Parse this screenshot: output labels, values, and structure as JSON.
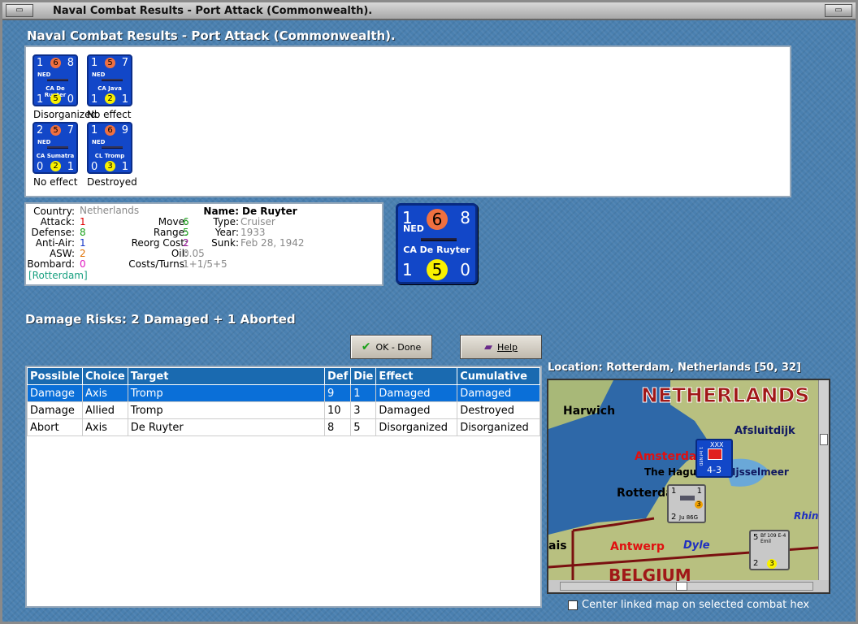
{
  "window": {
    "title": "Naval Combat Results - Port Attack (Commonwealth)."
  },
  "header": "Naval Combat Results - Port Attack (Commonwealth).",
  "units": [
    {
      "tl": "1",
      "tc": "6",
      "tr": "8",
      "nat": "NED",
      "name": "CA De Ruyter",
      "bl": "1",
      "bc": "5",
      "br": "0",
      "result": "Disorganized"
    },
    {
      "tl": "1",
      "tc": "5",
      "tr": "7",
      "nat": "NED",
      "name": "CA Java",
      "bl": "1",
      "bc": "2",
      "br": "1",
      "result": "No effect"
    },
    {
      "tl": "2",
      "tc": "5",
      "tr": "7",
      "nat": "NED",
      "name": "CA Sumatra",
      "bl": "0",
      "bc": "2",
      "br": "1",
      "result": "No effect"
    },
    {
      "tl": "1",
      "tc": "6",
      "tr": "9",
      "nat": "NED",
      "name": "CL Tromp",
      "bl": "0",
      "bc": "3",
      "br": "1",
      "result": "Destroyed"
    }
  ],
  "info": {
    "country_l": "Country:",
    "country": "Netherlands",
    "attack_l": "Attack:",
    "attack": "1",
    "defense_l": "Defense:",
    "defense": "8",
    "antiair_l": "Anti-Air:",
    "antiair": "1",
    "asw_l": "ASW:",
    "asw": "2",
    "bombard_l": "Bombard:",
    "bombard": "0",
    "port": "[Rotterdam]",
    "move_l": "Move:",
    "move": "6",
    "range_l": "Range:",
    "range": "5",
    "reorg_l": "Reorg Cost:",
    "reorg": "2",
    "oil_l": "Oil:",
    "oil": "0.05",
    "costs_l": "Costs/Turns:",
    "costs": "1+1/5+5",
    "name_l": "Name:",
    "name": "De Ruyter",
    "type_l": "Type:",
    "type": "Cruiser",
    "year_l": "Year:",
    "year": "1933",
    "sunk_l": "Sunk:",
    "sunk": "Feb 28, 1942"
  },
  "bigunit": {
    "tl": "1",
    "tc": "6",
    "tr": "8",
    "nat": "NED",
    "name": "CA De Ruyter",
    "bl": "1",
    "bc": "5",
    "br": "0"
  },
  "damage_risks": "Damage Risks: 2 Damaged + 1 Aborted",
  "buttons": {
    "ok": "OK - Done",
    "help": "Help"
  },
  "table": {
    "headers": [
      "Possible",
      "Choice",
      "Target",
      "Def",
      "Die",
      "Effect",
      "Cumulative"
    ],
    "rows": [
      [
        "Damage",
        "Axis",
        "Tromp",
        "9",
        "1",
        "Damaged",
        "Damaged"
      ],
      [
        "Damage",
        "Allied",
        "Tromp",
        "10",
        "3",
        "Damaged",
        "Destroyed"
      ],
      [
        "Abort",
        "Axis",
        "De Ruyter",
        "8",
        "5",
        "Disorganized",
        "Disorganized"
      ]
    ]
  },
  "location": "Location:  Rotterdam, Netherlands [50, 32]",
  "map": {
    "labels": [
      "NETHERLANDS",
      "Harwich",
      "Afsluitdijk",
      "Amsterdam",
      "The Hague",
      "Rotterdam",
      "Ijsselmeer",
      "Rhine",
      "Antwerp",
      "Dyle",
      "BELGIUM",
      "ais"
    ],
    "counter1": {
      "top": "XXX",
      "side": "1 Inf NED",
      "value": "4-3"
    },
    "counter2": {
      "tl": "1",
      "tr": "1",
      "bl": "2",
      "name": "Ju 86G",
      "bc": "3"
    },
    "counter3": {
      "tl": "5",
      "name": "Bf 109 E-4 Emil",
      "bl": "2",
      "bc": "3"
    }
  },
  "checkbox_label": "Center linked map on selected combat hex"
}
